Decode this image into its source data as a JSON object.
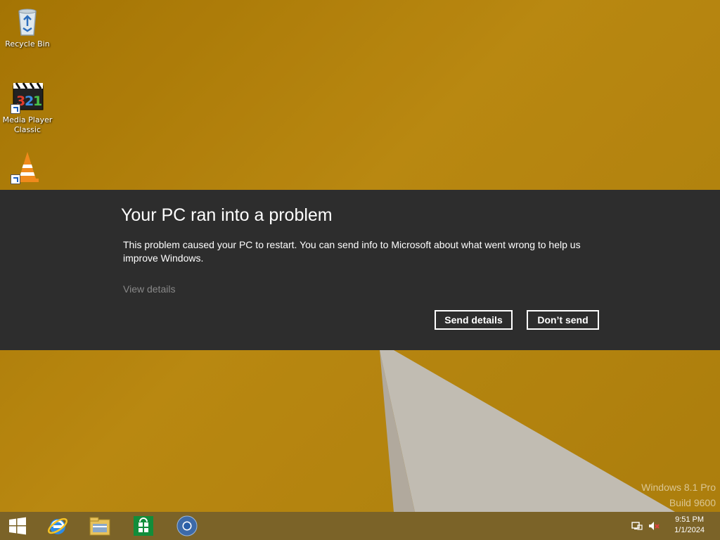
{
  "desktop": {
    "icons": [
      {
        "label": "Recycle Bin",
        "icon": "recycle-bin-icon"
      },
      {
        "label": "Media Player Classic",
        "icon": "media-player-classic-icon"
      },
      {
        "label": "",
        "icon": "vlc-icon"
      }
    ],
    "watermark": {
      "line1": "Windows 8.1 Pro",
      "line2": "Build 9600"
    }
  },
  "dialog": {
    "title": "Your PC ran into a problem",
    "message": "This problem caused your PC to restart. You can send info to Microsoft about what went wrong to help us improve Windows.",
    "view_details": "View details",
    "send_button": "Send details",
    "dont_send_button": "Don’t send"
  },
  "taskbar": {
    "items": [
      {
        "name": "start-button",
        "icon": "windows-logo-icon"
      },
      {
        "name": "internet-explorer",
        "icon": "internet-explorer-icon"
      },
      {
        "name": "file-explorer",
        "icon": "file-explorer-icon"
      },
      {
        "name": "store",
        "icon": "store-icon"
      },
      {
        "name": "chrome",
        "icon": "chromium-icon"
      }
    ],
    "tray": {
      "network_icon": "network-icon",
      "volume_icon": "volume-muted-icon"
    },
    "clock": {
      "time": "9:51 PM",
      "date": "1/1/2024"
    }
  },
  "colors": {
    "wallpaper": "#d69e0f",
    "dialog_bg": "#2d2d2d",
    "taskbar": "#7b6328"
  }
}
